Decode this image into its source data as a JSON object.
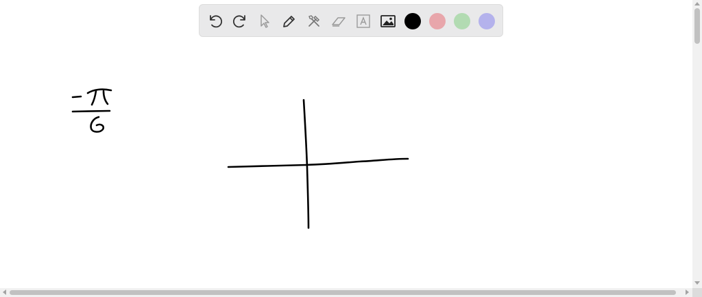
{
  "toolbar": {
    "tools": [
      {
        "name": "undo-icon"
      },
      {
        "name": "redo-icon"
      },
      {
        "name": "select-pointer-icon"
      },
      {
        "name": "pen-icon"
      },
      {
        "name": "tools-icon"
      },
      {
        "name": "eraser-icon"
      },
      {
        "name": "text-icon"
      },
      {
        "name": "image-icon"
      }
    ],
    "colors": [
      {
        "name": "black",
        "hex": "#000000"
      },
      {
        "name": "red",
        "hex": "#e8a6ab"
      },
      {
        "name": "green",
        "hex": "#b2dbb2"
      },
      {
        "name": "purple",
        "hex": "#b4b2ec"
      }
    ]
  },
  "canvas": {
    "ink_color": "#000000",
    "handwriting": "-π / 6"
  }
}
